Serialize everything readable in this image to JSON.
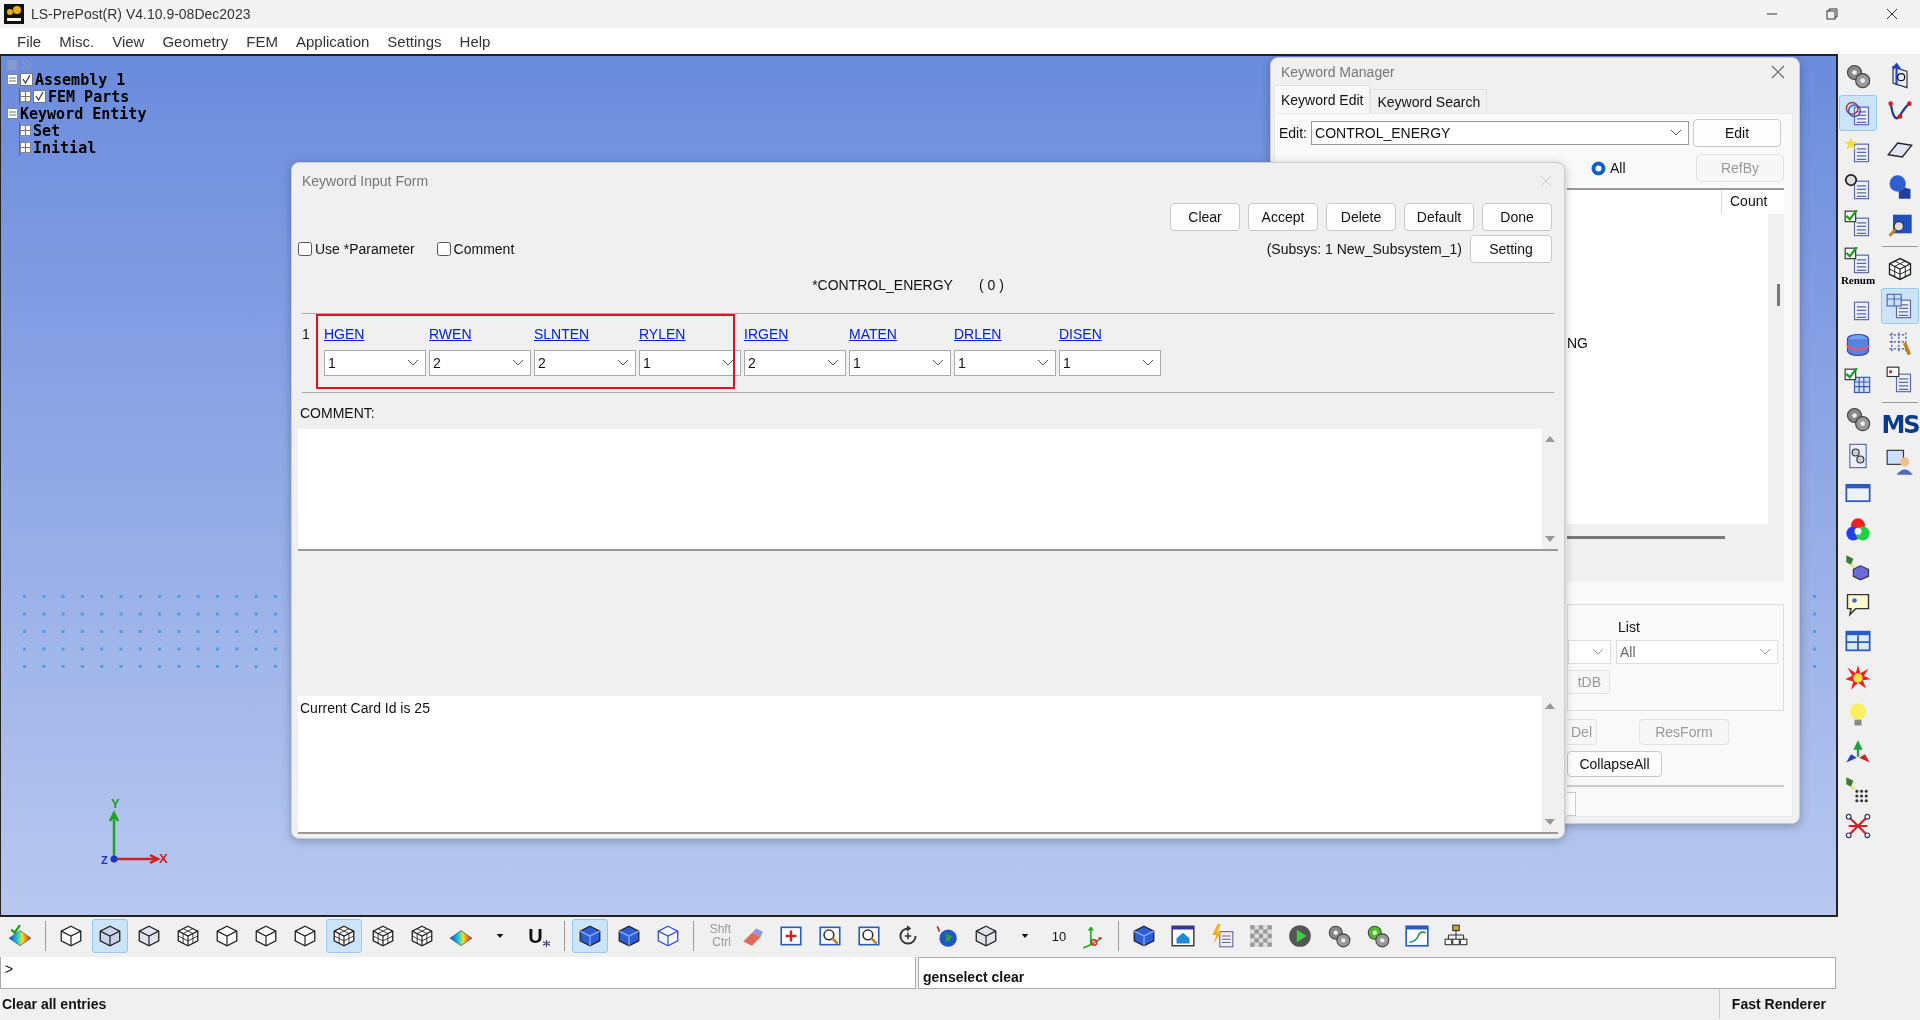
{
  "window": {
    "title": "LS-PrePost(R) V4.10.9-08Dec2023"
  },
  "menu": [
    "File",
    "Misc.",
    "View",
    "Geometry",
    "FEM",
    "Application",
    "Settings",
    "Help"
  ],
  "model_tree": [
    {
      "label": "Assembly 1",
      "expanded": true,
      "checked": true,
      "children": [
        {
          "label": "FEM Parts",
          "expanded": false,
          "checked": true
        }
      ]
    },
    {
      "label": "Keyword Entity",
      "expanded": true,
      "children": [
        {
          "label": "Set",
          "expanded": false
        },
        {
          "label": "Initial",
          "expanded": false
        }
      ]
    }
  ],
  "axis_triad": {
    "y_label": "Y",
    "x_label": "X",
    "z_label": "Z"
  },
  "keyword_manager": {
    "title": "Keyword Manager",
    "tabs": [
      {
        "label": "Keyword Edit",
        "selected": true
      },
      {
        "label": "Keyword Search",
        "selected": false
      }
    ],
    "edit_label": "Edit:",
    "edit_value": "CONTROL_ENERGY",
    "edit_button": {
      "label": "Edit",
      "disabled": false
    },
    "radio": {
      "label": "All",
      "selected": true
    },
    "refby_button": {
      "label": "RefBy",
      "disabled": true
    },
    "column_header": "Count",
    "list_fragment": "NG",
    "list_label": "List",
    "list_value": "All",
    "partial_button": {
      "label": "tDB",
      "disabled": true
    },
    "del_button": {
      "label": "Del",
      "disabled": true
    },
    "resform_button": {
      "label": "ResForm",
      "disabled": true
    },
    "collapse_button": {
      "label": "CollapseAll",
      "disabled": false
    }
  },
  "keyword_input_form": {
    "title": "Keyword Input Form",
    "buttons": [
      "Clear",
      "Accept",
      "Delete",
      "Default",
      "Done"
    ],
    "options": [
      {
        "label": "Use *Parameter",
        "checked": false
      },
      {
        "label": "Comment",
        "checked": false
      }
    ],
    "subsystem": "(Subsys: 1 New_Subsystem_1)",
    "setting_button": "Setting",
    "keyword": "*CONTROL_ENERGY",
    "count": "( 0 )",
    "card_index": "1",
    "fields": [
      {
        "name": "HGEN",
        "value": "1",
        "highlighted": true
      },
      {
        "name": "RWEN",
        "value": "2",
        "highlighted": true
      },
      {
        "name": "SLNTEN",
        "value": "2",
        "highlighted": true
      },
      {
        "name": "RYLEN",
        "value": "1",
        "highlighted": true
      },
      {
        "name": "IRGEN",
        "value": "2",
        "highlighted": false
      },
      {
        "name": "MATEN",
        "value": "1",
        "highlighted": false
      },
      {
        "name": "DRLEN",
        "value": "1",
        "highlighted": false
      },
      {
        "name": "DISEN",
        "value": "1",
        "highlighted": false
      }
    ],
    "comment_label": "COMMENT:",
    "message": "Current Card Id is 25"
  },
  "bottom_toolbar": {
    "buttons": [
      {
        "selected": false
      },
      {
        "selected": false
      },
      {
        "selected": true
      },
      {
        "selected": false
      },
      {
        "selected": false
      },
      {
        "selected": false
      },
      {
        "selected": false
      },
      {
        "selected": false
      },
      {
        "selected": true
      },
      {
        "selected": false
      },
      {
        "selected": false
      },
      {
        "selected": false
      },
      {
        "selected": false
      },
      {
        "selected": false
      },
      {
        "selected": true
      },
      {
        "selected": false
      },
      {
        "selected": false
      },
      {
        "selected": false
      },
      {
        "selected": false
      },
      {
        "selected": false
      },
      {
        "selected": false
      },
      {
        "selected": false
      },
      {
        "selected": false
      },
      {
        "selected": false
      },
      {
        "selected": false
      },
      {
        "selected": false
      },
      {
        "selected": false
      },
      {
        "selected": false
      },
      {
        "selected": false
      },
      {
        "selected": false
      },
      {
        "selected": false
      },
      {
        "selected": false
      },
      {
        "selected": false
      },
      {
        "selected": false
      },
      {
        "selected": false
      }
    ],
    "u_label": "U",
    "modifier_labels": [
      "Shft",
      "Ctrl"
    ],
    "depth_value": "10"
  },
  "right_toolbar": {
    "column_1": [
      {
        "selected": false
      },
      {
        "selected": true
      },
      {
        "selected": false
      },
      {
        "selected": false
      },
      {
        "selected": false
      },
      {
        "selected": false
      },
      {
        "selected": false
      },
      {
        "selected": false
      },
      {
        "selected": false
      },
      {
        "selected": false
      },
      {
        "selected": false
      },
      {
        "selected": false
      },
      {
        "selected": false
      },
      {
        "selected": false
      },
      {
        "selected": false
      },
      {
        "selected": false
      },
      {
        "selected": false
      },
      {
        "selected": false
      },
      {
        "selected": false
      },
      {
        "selected": false
      },
      {
        "selected": false
      }
    ],
    "column_2": [
      {
        "selected": false
      },
      {
        "selected": false
      },
      {
        "selected": false
      },
      {
        "selected": false
      },
      {
        "selected": false
      },
      {
        "selected": false
      },
      {
        "selected": true
      },
      {
        "selected": false
      },
      {
        "selected": false
      },
      {
        "selected": false
      },
      {
        "selected": false
      }
    ],
    "renum_label": "Renum",
    "ms_label": "MS"
  },
  "command_prompt": ">",
  "command_output": "genselect clear",
  "status_bar": {
    "message": "Clear all entries",
    "renderer": "Fast Renderer"
  }
}
